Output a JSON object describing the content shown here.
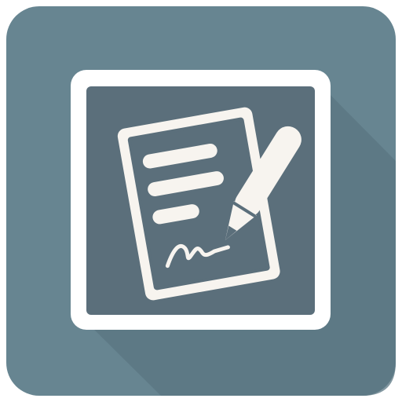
{
  "icon": {
    "name": "document-signing-app-icon",
    "glyph": "contract-with-pencil-and-signature",
    "colors": {
      "background": "#678591",
      "long_shadow": "#5a7581",
      "frame_outline": "#ffffff",
      "frame_fill": "#5b6f7b",
      "paper": "#f7f4ef",
      "line_marks": "#f7f4ef",
      "signature_ink": "#f7f4ef",
      "pencil": "#f7f4ef"
    }
  }
}
